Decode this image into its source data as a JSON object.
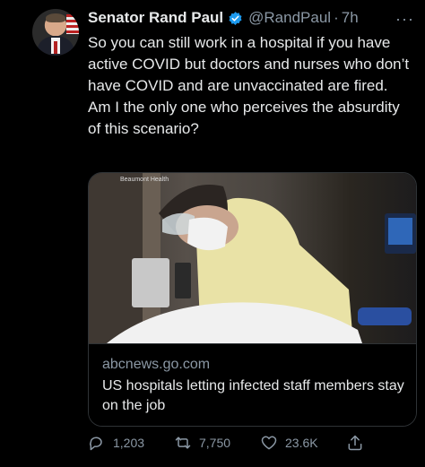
{
  "tweet": {
    "author_name": "Senator Rand Paul",
    "handle": "@RandPaul",
    "separator": "·",
    "time": "7h",
    "more": "···",
    "text": "So you can still work in a hospital if you have active COVID but doctors and nurses who don’t have COVID and are unvaccinated are fired. Am I the only one who perceives the absurdity of this scenario?"
  },
  "card": {
    "image_credit": "Beaumont Health",
    "domain": "abcnews.go.com",
    "headline": "US hospitals letting infected staff members stay on the job"
  },
  "actions": {
    "replies": "1,203",
    "retweets": "7,750",
    "likes": "23.6K"
  },
  "colors": {
    "background": "#000000",
    "text": "#e7e9ea",
    "muted": "#8b98a5",
    "verified": "#1d9bf0"
  }
}
